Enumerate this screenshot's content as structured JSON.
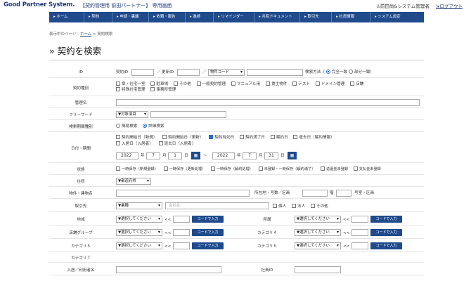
{
  "header": {
    "logo": "Good Partner System.",
    "system_name": "【契約管理用 前田パートナー】 専用画面",
    "user": "前田尚&システム管理者",
    "logout": "ログアウト"
  },
  "nav": [
    "ホーム",
    "契約",
    "申請・裏議",
    "依頼・報告",
    "進捗",
    "リマインダー",
    "共有ドキュメント",
    "取引先",
    "社員情報",
    "システム設定"
  ],
  "breadcrumb": {
    "prefix": "表示中のページ：",
    "home": "ホーム",
    "sep": " > ",
    "current": "契約検索"
  },
  "page_title": "» 契約を検索",
  "form": {
    "id_label": "ID",
    "contract_id_label": "契約ID",
    "renew_id_label": "更新ID",
    "slash": "／",
    "product_code": "物件コード",
    "search_method_label": "検索方法（",
    "search_exact": "完全一致",
    "search_partial": "部分一致）",
    "type_label": "契約種別",
    "types": [
      "章・社宅一室",
      "駐車場",
      "その他",
      "一般契約管理",
      "マニュアル用",
      "賃主物件",
      "テスト",
      "ドメイン管理",
      "店舗",
      "特殊社宅管理",
      "事務所管理"
    ],
    "mgmt_label": "管理名",
    "free_label": "フリーワード",
    "free_target": "▼対象項目",
    "period_label": "検索期間種別",
    "period_simple": "簡易検索",
    "period_detail": "詳細検索",
    "date_label": "日付・期間",
    "date_types": [
      "契約開始日（新規）",
      "契約開始日（更新）",
      "契約有効日",
      "契約満了日",
      "解約日",
      "退去日（解約情報）",
      "入居日（入居者）",
      "退去日（入居者）"
    ],
    "date_from": {
      "year": "2022",
      "y": "年",
      "month": "7",
      "m": "月",
      "day": "1",
      "d": "日",
      "cal": "▦"
    },
    "tilde": "〜",
    "date_to": {
      "year": "2022",
      "y": "年",
      "month": "7",
      "m": "月",
      "day": "31",
      "d": "日",
      "cal": "▦"
    },
    "status_label": "状態",
    "statuses": [
      "一時保存（新規登録）",
      "一時保存（更新処理）",
      "一時保存（解約処理）",
      "未登録・一時保存（解約満了）",
      "返還金未登録",
      "支払金未登録"
    ],
    "address_label": "住所",
    "prefecture": "▼都道府県",
    "building_label": "物件・建物名",
    "lot_label": "所在地・号数／区画",
    "floor_unit": "階",
    "room_label": "号室・区画",
    "partner_label": "取引先",
    "partner_type": "▼業種",
    "company_placeholder": "会社名",
    "individual": "個人",
    "corporation": "法人",
    "other": "その他",
    "region_label": "地域",
    "select_placeholder": "▼選択してください",
    "arrow": "<<",
    "code_btn": "コードで入力",
    "affiliation_label": "所属",
    "store_group_label": "店舗グループ",
    "category4_label": "カテゴリ４",
    "category5_label": "カテゴリ５",
    "category6_label": "カテゴリ６",
    "category7_label": "カテゴリ７",
    "residents_label": "入居／利用者名",
    "employee_id_label": "社員ID"
  },
  "colors": {
    "nav_bg": "#1f4a8c",
    "accent": "#1f6fd1"
  }
}
